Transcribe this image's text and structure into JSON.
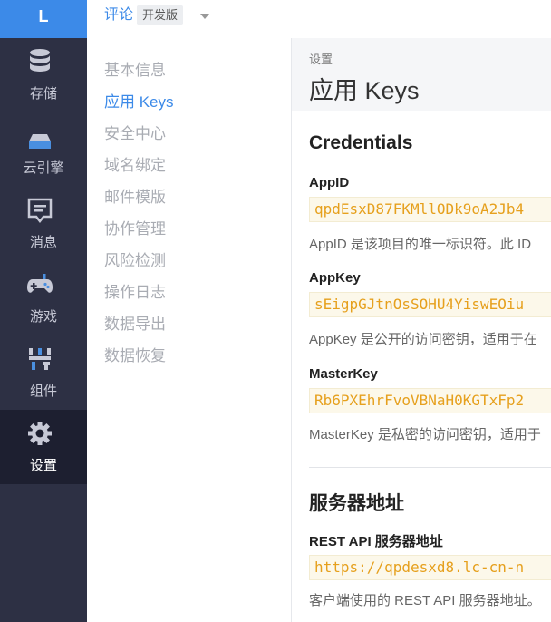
{
  "rail": {
    "logo": "L",
    "items": [
      {
        "label": "存储",
        "icon": "database-icon"
      },
      {
        "label": "云引擎",
        "icon": "server-icon"
      },
      {
        "label": "消息",
        "icon": "message-icon"
      },
      {
        "label": "游戏",
        "icon": "gamepad-icon"
      },
      {
        "label": "组件",
        "icon": "components-icon"
      },
      {
        "label": "设置",
        "icon": "gear-icon"
      }
    ]
  },
  "topbar": {
    "app_name": "评论",
    "plan": "开发版"
  },
  "subnav": {
    "items": [
      "基本信息",
      "应用 Keys",
      "安全中心",
      "域名绑定",
      "邮件模版",
      "协作管理",
      "风险检测",
      "操作日志",
      "数据导出",
      "数据恢复"
    ]
  },
  "main": {
    "breadcrumb": "设置",
    "title": "应用 Keys",
    "credentials": {
      "heading": "Credentials",
      "appid": {
        "label": "AppID",
        "value": "qpdEsxD87FKMllODk9oA2Jb4",
        "desc": "AppID 是该项目的唯一标识符。此 ID"
      },
      "appkey": {
        "label": "AppKey",
        "value": "sEigpGJtnOsSOHU4YiswEOiu",
        "desc": "AppKey 是公开的访问密钥，适用于在"
      },
      "masterkey": {
        "label": "MasterKey",
        "value": "Rb6PXEhrFvoVBNaH0KGTxFp2",
        "desc": "MasterKey 是私密的访问密钥，适用于"
      }
    },
    "server": {
      "heading": "服务器地址",
      "rest": {
        "label": "REST API 服务器地址",
        "value": "https://qpdesxd8.lc-cn-n",
        "desc": "客户端使用的 REST API 服务器地址。"
      }
    }
  },
  "colors": {
    "accent": "#3c8ae8",
    "rail_bg": "#2d3044",
    "code_text": "#e6a01d"
  }
}
